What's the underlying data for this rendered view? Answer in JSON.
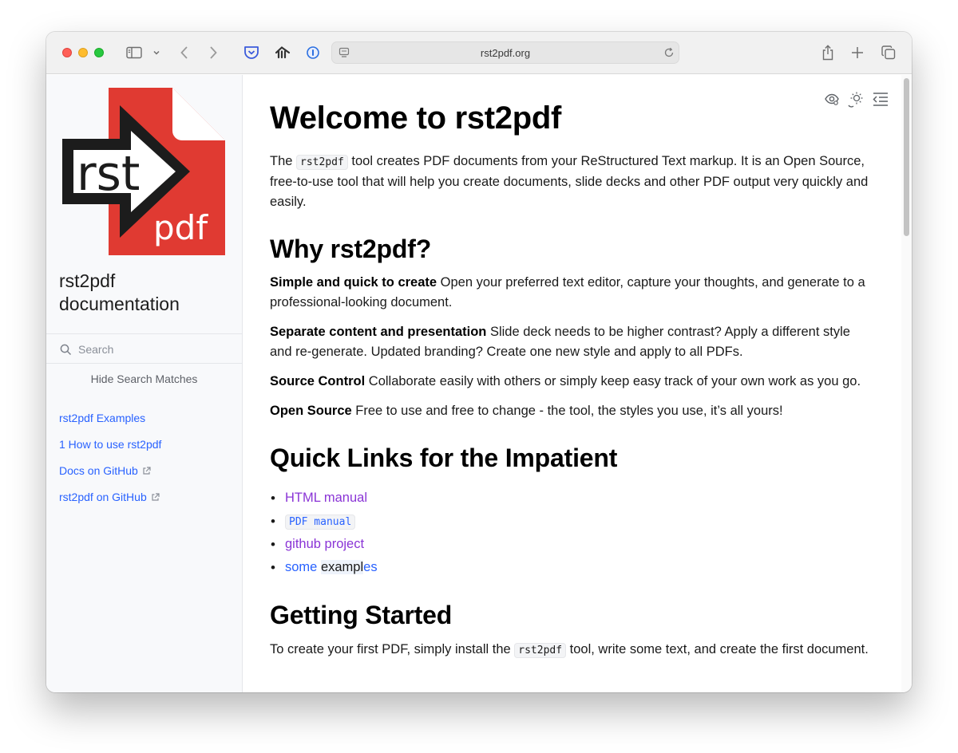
{
  "browser": {
    "url": "rst2pdf.org"
  },
  "sidebar": {
    "logo_text_top": "rst",
    "logo_text_bottom": "pdf",
    "project_title": "rst2pdf documentation",
    "search_placeholder": "Search",
    "hide_search_matches": "Hide Search Matches",
    "nav": [
      {
        "label": "rst2pdf Examples",
        "external": false
      },
      {
        "label": "1 How to use rst2pdf",
        "external": false
      },
      {
        "label": "Docs on GitHub",
        "external": true
      },
      {
        "label": "rst2pdf on GitHub",
        "external": true
      }
    ]
  },
  "content": {
    "title": "Welcome to rst2pdf",
    "intro": {
      "pre": "The ",
      "code": "rst2pdf",
      "post": " tool creates PDF documents from your ReStructured Text markup. It is an Open Source, free-to-use tool that will help you create documents, slide decks and other PDF output very quickly and easily."
    },
    "why_heading": "Why rst2pdf?",
    "features": [
      {
        "term": "Simple and quick to create",
        "text": " Open your preferred text editor, capture your thoughts, and generate to a professional-looking document."
      },
      {
        "term": "Separate content and presentation",
        "text": " Slide deck needs to be higher contrast? Apply a different style and re-generate. Updated branding? Create one new style and apply to all PDFs."
      },
      {
        "term": "Source Control",
        "text": " Collaborate easily with others or simply keep easy track of your own work as you go."
      },
      {
        "term": "Open Source",
        "text": " Free to use and free to change - the tool, the styles you use, it’s all yours!"
      }
    ],
    "quick_heading": "Quick Links for the Impatient",
    "quick_links": {
      "html_manual": "HTML manual",
      "pdf_manual": "PDF manual",
      "github_project": "github project",
      "some_examples_a": "some ",
      "some_examples_b": "exampl",
      "some_examples_c": "es"
    },
    "getting_started_heading": "Getting Started",
    "getting_started": {
      "pre": "To create your first PDF, simply install the ",
      "code": "rst2pdf",
      "post": " tool, write some text, and create the first document."
    }
  }
}
